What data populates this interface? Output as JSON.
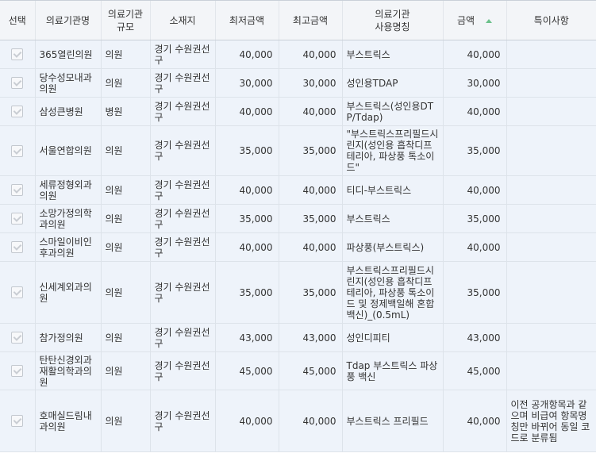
{
  "columns": {
    "select": "선택",
    "name": "의료기관명",
    "scale": "의료기관\n규모",
    "location": "소재지",
    "min_price": "최저금액",
    "max_price": "최고금액",
    "usage_name": "의료기관\n사용명칭",
    "amount": "금액",
    "note": "특이사항"
  },
  "rows": [
    {
      "name": "365열린의원",
      "scale": "의원",
      "location": "경기 수원권선구",
      "min": "40,000",
      "max": "40,000",
      "usage": "부스트릭스",
      "amount": "40,000",
      "note": ""
    },
    {
      "name": "당수성모내과의원",
      "scale": "의원",
      "location": "경기 수원권선구",
      "min": "30,000",
      "max": "30,000",
      "usage": "성인용TDAP",
      "amount": "30,000",
      "note": ""
    },
    {
      "name": "삼성큰병원",
      "scale": "병원",
      "location": "경기 수원권선구",
      "min": "40,000",
      "max": "40,000",
      "usage": "부스트릭스(성인용DTP/Tdap)",
      "amount": "40,000",
      "note": ""
    },
    {
      "name": "서울연합의원",
      "scale": "의원",
      "location": "경기 수원권선구",
      "min": "35,000",
      "max": "35,000",
      "usage": "\"부스트릭스프리필드시린지(성인용 흡착디프테리아, 파상풍 톡소이드\"",
      "amount": "35,000",
      "note": ""
    },
    {
      "name": "세류정형외과의원",
      "scale": "의원",
      "location": "경기 수원권선구",
      "min": "40,000",
      "max": "40,000",
      "usage": "티디-부스트릭스",
      "amount": "40,000",
      "note": ""
    },
    {
      "name": "소망가정의학과의원",
      "scale": "의원",
      "location": "경기 수원권선구",
      "min": "35,000",
      "max": "35,000",
      "usage": "부스트릭스",
      "amount": "35,000",
      "note": ""
    },
    {
      "name": "스마일이비인후과의원",
      "scale": "의원",
      "location": "경기 수원권선구",
      "min": "40,000",
      "max": "40,000",
      "usage": "파상풍(부스트릭스)",
      "amount": "40,000",
      "note": ""
    },
    {
      "name": "신세계외과의원",
      "scale": "의원",
      "location": "경기 수원권선구",
      "min": "35,000",
      "max": "35,000",
      "usage": "부스트릭스프리필드시린지(성인용 흡착디프테리아, 파상풍 톡소이드 및 정제백일해 혼합 백신)_(0.5mL)",
      "amount": "35,000",
      "note": ""
    },
    {
      "name": "참가정의원",
      "scale": "의원",
      "location": "경기 수원권선구",
      "min": "43,000",
      "max": "43,000",
      "usage": "성인디피티",
      "amount": "43,000",
      "note": ""
    },
    {
      "name": "탄탄신경외과재활의학과의원",
      "scale": "의원",
      "location": "경기 수원권선구",
      "min": "45,000",
      "max": "45,000",
      "usage": "Tdap 부스트릭스 파상풍 백신",
      "amount": "45,000",
      "note": ""
    },
    {
      "name": "호매실드림내과의원",
      "scale": "의원",
      "location": "경기 수원권선구",
      "min": "40,000",
      "max": "40,000",
      "usage": "부스트릭스 프리필드",
      "amount": "40,000",
      "note": "이전 공개항목과 같으며 비급여 항목명칭만 바뀌어 동일 코드로 분류됨"
    }
  ]
}
